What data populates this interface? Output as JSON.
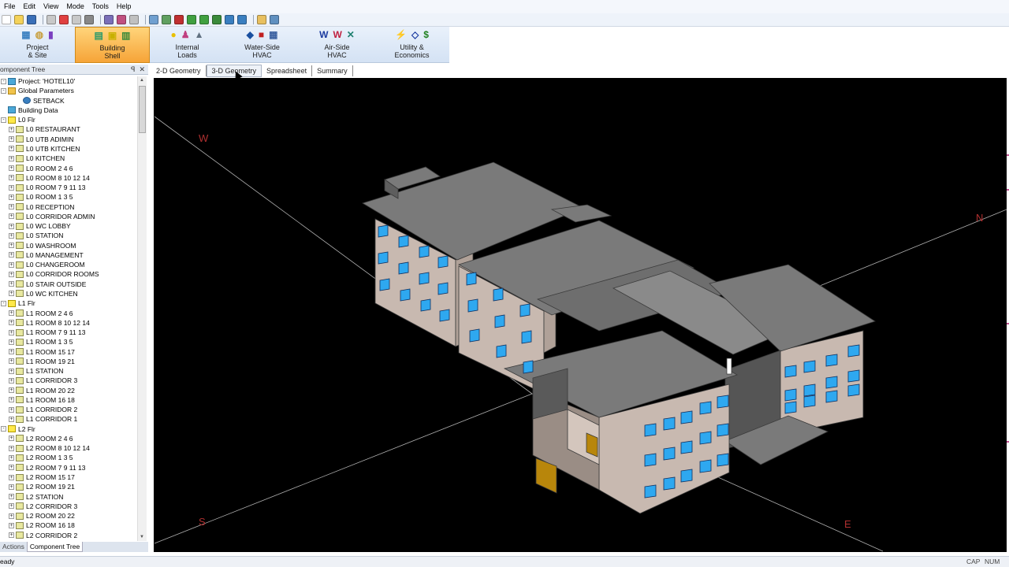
{
  "menu": [
    "File",
    "Edit",
    "View",
    "Mode",
    "Tools",
    "Help"
  ],
  "ribbon": [
    {
      "label_1": "Project",
      "label_2": "& Site",
      "icons": [
        "▦",
        "◍",
        "▮"
      ]
    },
    {
      "label_1": "Building",
      "label_2": "Shell",
      "icons": [
        "▤",
        "▣",
        "▥"
      ],
      "active": true
    },
    {
      "label_1": "Internal",
      "label_2": "Loads",
      "icons": [
        "●",
        "♟",
        "▲"
      ]
    },
    {
      "label_1": "Water-Side",
      "label_2": "HVAC",
      "icons": [
        "◆",
        "■",
        "▦"
      ]
    },
    {
      "label_1": "Air-Side",
      "label_2": "HVAC",
      "icons": [
        "W",
        "W",
        "✕"
      ]
    },
    {
      "label_1": "Utility &",
      "label_2": "Economics",
      "icons": [
        "⚡",
        "◇",
        "$"
      ]
    }
  ],
  "panel": {
    "title": "omponent Tree",
    "pin": "ꟼ",
    "close": "✕"
  },
  "tree": [
    {
      "text": "Project:  'HOTEL10'",
      "indent": 0,
      "icon": "data",
      "exp": "-"
    },
    {
      "text": "Global Parameters",
      "indent": 1,
      "icon": "folder",
      "exp": "-"
    },
    {
      "text": "SETBACK",
      "indent": 2,
      "icon": "globe",
      "exp": ""
    },
    {
      "text": "Building Data",
      "indent": 1,
      "icon": "data",
      "exp": ""
    },
    {
      "text": "L0 Flr",
      "indent": 1,
      "icon": "flr",
      "exp": "-"
    },
    {
      "text": "L0 RESTAURANT",
      "indent": 2,
      "icon": "room",
      "exp": "+"
    },
    {
      "text": "L0 UTB ADIMIN",
      "indent": 2,
      "icon": "room",
      "exp": "+"
    },
    {
      "text": "L0 UTB KITCHEN",
      "indent": 2,
      "icon": "room",
      "exp": "+"
    },
    {
      "text": "L0 KITCHEN",
      "indent": 2,
      "icon": "room",
      "exp": "+"
    },
    {
      "text": "L0 ROOM 2 4 6",
      "indent": 2,
      "icon": "room",
      "exp": "+"
    },
    {
      "text": "L0 ROOM 8 10 12 14",
      "indent": 2,
      "icon": "room",
      "exp": "+"
    },
    {
      "text": "L0 ROOM 7 9 11 13",
      "indent": 2,
      "icon": "room",
      "exp": "+"
    },
    {
      "text": "L0 ROOM 1 3 5",
      "indent": 2,
      "icon": "room",
      "exp": "+"
    },
    {
      "text": "L0 RECEPTION",
      "indent": 2,
      "icon": "room",
      "exp": "+"
    },
    {
      "text": "L0 CORRIDOR ADMIN",
      "indent": 2,
      "icon": "room",
      "exp": "+"
    },
    {
      "text": "L0 WC LOBBY",
      "indent": 2,
      "icon": "room",
      "exp": "+"
    },
    {
      "text": "L0 STATION",
      "indent": 2,
      "icon": "room",
      "exp": "+"
    },
    {
      "text": "L0 WASHROOM",
      "indent": 2,
      "icon": "room",
      "exp": "+"
    },
    {
      "text": "L0 MANAGEMENT",
      "indent": 2,
      "icon": "room",
      "exp": "+"
    },
    {
      "text": "L0 CHANGEROOM",
      "indent": 2,
      "icon": "room",
      "exp": "+"
    },
    {
      "text": "L0 CORRIDOR ROOMS",
      "indent": 2,
      "icon": "room",
      "exp": "+"
    },
    {
      "text": "L0 STAIR OUTSIDE",
      "indent": 2,
      "icon": "room",
      "exp": "+"
    },
    {
      "text": "L0 WC KITCHEN",
      "indent": 2,
      "icon": "room",
      "exp": "+"
    },
    {
      "text": "L1 Flr",
      "indent": 1,
      "icon": "flr",
      "exp": "-"
    },
    {
      "text": "L1 ROOM 2 4 6",
      "indent": 2,
      "icon": "room",
      "exp": "+"
    },
    {
      "text": "L1 ROOM 8 10 12 14",
      "indent": 2,
      "icon": "room",
      "exp": "+"
    },
    {
      "text": "L1 ROOM 7 9 11 13",
      "indent": 2,
      "icon": "room",
      "exp": "+"
    },
    {
      "text": "L1 ROOM 1 3 5",
      "indent": 2,
      "icon": "room",
      "exp": "+"
    },
    {
      "text": "L1 ROOM 15 17",
      "indent": 2,
      "icon": "room",
      "exp": "+"
    },
    {
      "text": "L1 ROOM 19 21",
      "indent": 2,
      "icon": "room",
      "exp": "+"
    },
    {
      "text": "L1 STATION",
      "indent": 2,
      "icon": "room",
      "exp": "+"
    },
    {
      "text": "L1 CORRIDOR 3",
      "indent": 2,
      "icon": "room",
      "exp": "+"
    },
    {
      "text": "L1 ROOM 20 22",
      "indent": 2,
      "icon": "room",
      "exp": "+"
    },
    {
      "text": "L1 ROOM 16 18",
      "indent": 2,
      "icon": "room",
      "exp": "+"
    },
    {
      "text": "L1 CORRIDOR 2",
      "indent": 2,
      "icon": "room",
      "exp": "+"
    },
    {
      "text": "L1 CORRIDOR 1",
      "indent": 2,
      "icon": "room",
      "exp": "+"
    },
    {
      "text": "L2 Flr",
      "indent": 1,
      "icon": "flr",
      "exp": "-"
    },
    {
      "text": "L2 ROOM 2 4 6",
      "indent": 2,
      "icon": "room",
      "exp": "+"
    },
    {
      "text": "L2 ROOM 8 10 12 14",
      "indent": 2,
      "icon": "room",
      "exp": "+"
    },
    {
      "text": "L2 ROOM 1 3 5",
      "indent": 2,
      "icon": "room",
      "exp": "+"
    },
    {
      "text": "L2 ROOM 7 9 11 13",
      "indent": 2,
      "icon": "room",
      "exp": "+"
    },
    {
      "text": "L2 ROOM 15 17",
      "indent": 2,
      "icon": "room",
      "exp": "+"
    },
    {
      "text": "L2 ROOM 19 21",
      "indent": 2,
      "icon": "room",
      "exp": "+"
    },
    {
      "text": "L2 STATION",
      "indent": 2,
      "icon": "room",
      "exp": "+"
    },
    {
      "text": "L2 CORRIDOR 3",
      "indent": 2,
      "icon": "room",
      "exp": "+"
    },
    {
      "text": "L2 ROOM 20 22",
      "indent": 2,
      "icon": "room",
      "exp": "+"
    },
    {
      "text": "L2 ROOM 16 18",
      "indent": 2,
      "icon": "room",
      "exp": "+"
    },
    {
      "text": "L2 CORRIDOR 2",
      "indent": 2,
      "icon": "room",
      "exp": "+"
    }
  ],
  "bottom_tabs": [
    {
      "label": "Actions",
      "selected": false
    },
    {
      "label": "Component Tree",
      "selected": true
    }
  ],
  "view_tabs": [
    {
      "label": "2-D Geometry",
      "selected": false
    },
    {
      "label": "3-D Geometry",
      "selected": true
    },
    {
      "label": "Spreadsheet",
      "selected": false
    },
    {
      "label": "Summary",
      "selected": false
    }
  ],
  "compass": {
    "w": "W",
    "n": "N",
    "s": "S",
    "e": "E"
  },
  "status": {
    "text": "eady",
    "cap": "CAP",
    "num": "NUM"
  },
  "colors": {
    "viewport_bg": "#000000",
    "roof": "#7a7a7a",
    "wall": "#c8b9b0",
    "window": "#2ea8f0",
    "door": "#b8860b",
    "axis_line": "#b0b0b0",
    "compass_label": "#b03030",
    "ribbon_active": "#f6a438"
  }
}
